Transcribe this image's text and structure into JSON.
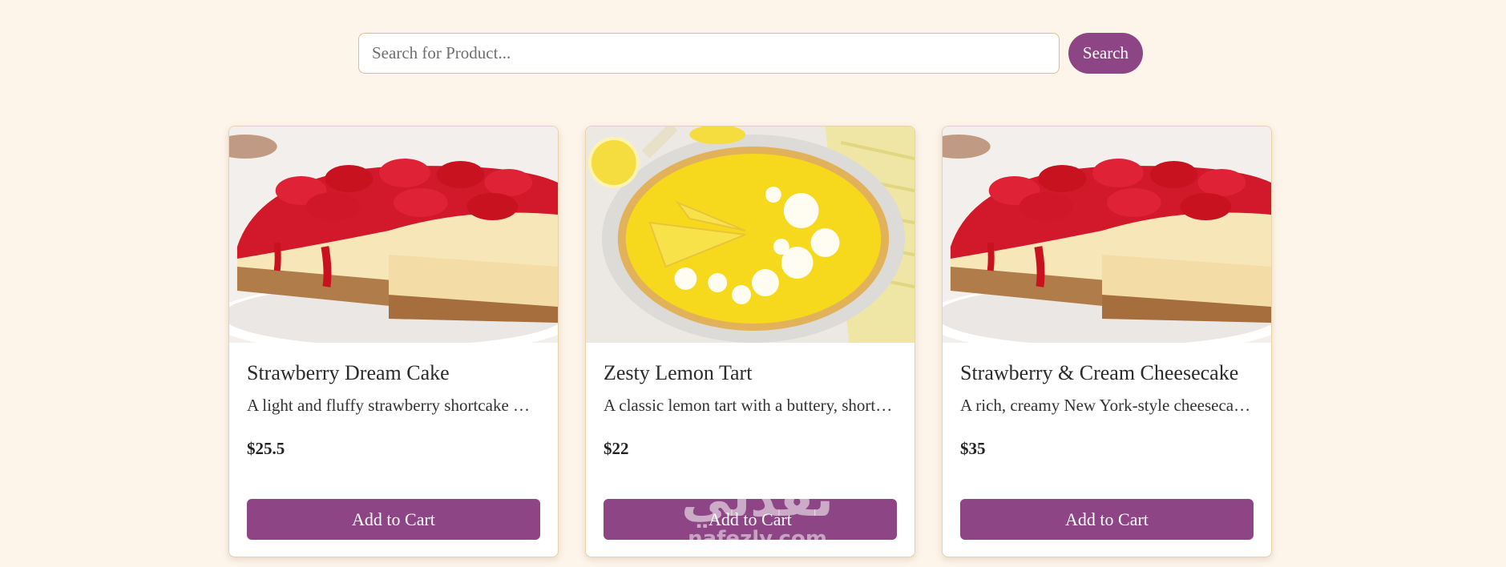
{
  "search": {
    "placeholder": "Search for Product...",
    "button_label": "Search"
  },
  "products": [
    {
      "title": "Strawberry Dream Cake",
      "description": "A light and fluffy strawberry shortcake with fresh cream",
      "price": "$25.5",
      "button_label": "Add to Cart",
      "image": "strawberry-cheesecake"
    },
    {
      "title": "Zesty Lemon Tart",
      "description": "A classic lemon tart with a buttery, shortbread crust",
      "price": "$22",
      "button_label": "Add to Cart",
      "image": "lemon-tart"
    },
    {
      "title": "Strawberry & Cream Cheesecake",
      "description": "A rich, creamy New York-style cheesecake with strawberries",
      "price": "$35",
      "button_label": "Add to Cart",
      "image": "strawberry-cheesecake"
    }
  ],
  "watermark": {
    "arabic": "نفذلي",
    "latin": "nafezly.com"
  },
  "colors": {
    "background": "#fdf4ea",
    "accent": "#8e4585",
    "card_border": "#e6d3a8"
  }
}
